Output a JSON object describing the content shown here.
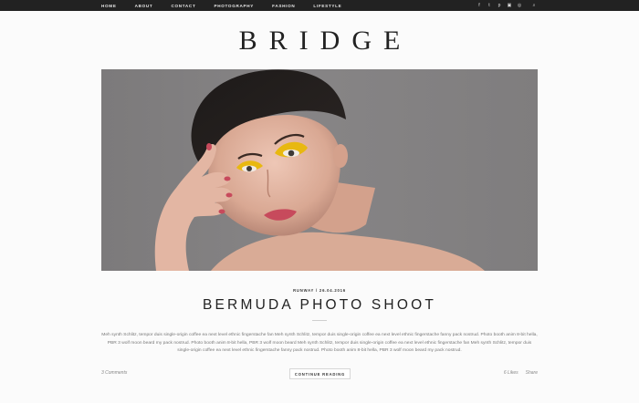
{
  "nav": {
    "items": [
      "HOME",
      "ABOUT",
      "CONTACT",
      "PHOTOGRAPHY",
      "FASHION",
      "LIFESTYLE"
    ]
  },
  "social": {
    "icons": [
      "facebook-icon",
      "twitter-icon",
      "pinterest-icon",
      "instagram-icon",
      "dribbble-icon"
    ],
    "glyphs": [
      "f",
      "t",
      "p",
      "▣",
      "◎"
    ],
    "search_glyph": "⌕"
  },
  "brand": {
    "logo": "BRIDGE"
  },
  "post": {
    "meta": "RUNWAY / 26.04.2016",
    "title": "BERMUDA PHOTO SHOOT",
    "excerpt": "Meh synth Schlitz, tempor duis single-origin coffee ea next level ethnic fingerstache fan Meh synth Schlitz, tempor duis single-origin coffee ea next level ethnic fingerstache fanny pack nostrud. Photo booth anim 8-bit hella, PBR 3 wolf moon beard my pack nostrud. Photo booth anim 8-bit hella, PBR 3 wolf moon beard Meh synth Schlitz, tempor duis single-origin coffee ea next level ethnic fingerstache fan Meh synth Schlitz, tempor duis single-origin coffee ea next level ethnic fingerstache fanny pack nostrud. Photo booth anim 8-bit hella, PBR 3 wolf moon beard my pack nostrud.",
    "comments": "3 Comments",
    "continue_label": "CONTINUE READING",
    "likes": "6  Likes",
    "share": "Share"
  },
  "colors": {
    "topbar": "#222222",
    "background": "#fbfbfb",
    "hero_backdrop": "#848283",
    "eyeshadow": "#e8b810",
    "lips_nails": "#c74a5c"
  }
}
